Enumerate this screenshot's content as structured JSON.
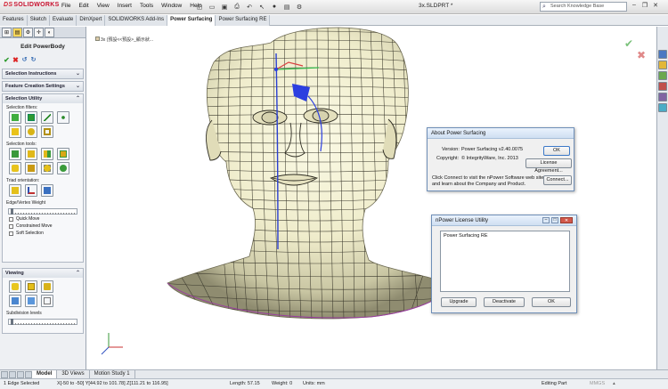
{
  "titlebar": {
    "logo": "SOLIDWORKS",
    "menus": [
      "File",
      "Edit",
      "View",
      "Insert",
      "Tools",
      "Window",
      "Help"
    ],
    "doc_title": "3x.SLDPRT *",
    "search_placeholder": "Search Knowledge Base"
  },
  "command_tabs": [
    "Features",
    "Sketch",
    "Evaluate",
    "DimXpert",
    "SOLIDWORKS Add-Ins",
    "Power Surfacing",
    "Power Surfacing RE"
  ],
  "active_command_tab": "Power Surfacing",
  "property_manager": {
    "title": "Edit PowerBody",
    "sections": {
      "selection_instructions": "Selection Instructions",
      "feature_creation_settings": "Feature Creation Settings",
      "selection_utility": "Selection Utility",
      "viewing": "Viewing"
    },
    "labels": {
      "selection_filters": "Selection filters:",
      "selection_tools": "Selection tools:",
      "triad_orientation": "Triad orientation:",
      "edge_vertex_weight": "Edge/Vertex Weight",
      "subdivision_levels": "Subdivision levels"
    },
    "checkboxes": [
      "Quick Move",
      "Constrained Move",
      "Soft Selection"
    ]
  },
  "viewport": {
    "breadcrumb": "3x (預設<<預設>_顯示狀..."
  },
  "about_dialog": {
    "title": "About Power Surfacing",
    "version_label": "Version:",
    "version_value": "Power Surfacing v2.40.0075",
    "copyright_label": "Copyright:",
    "copyright_value": "© IntegrityWare, Inc. 2013",
    "connect_text_1": "Click Connect to visit the nPower Software web site",
    "connect_text_2": "and learn about the Company and Product.",
    "ok_label": "OK",
    "license_label": "License Agreement...",
    "connect_label": "Connect..."
  },
  "license_dialog": {
    "title": "nPower License Utility",
    "list_item": "Power Surfacing RE",
    "upgrade_label": "Upgrade",
    "deactivate_label": "Deactivate",
    "ok_label": "OK"
  },
  "model_tabs": [
    "Model",
    "3D Views",
    "Motion Study 1"
  ],
  "status": {
    "selection": "1 Edge Selected",
    "coords": "X[-50 to -50]  Y[44.92 to 101.78]  Z[111.21 to 116.95]",
    "length": "Length: 57.15",
    "weight": "Weight: 0",
    "units": "Units: mm",
    "mode": "Editing Part",
    "unit_system": "MMGS"
  }
}
